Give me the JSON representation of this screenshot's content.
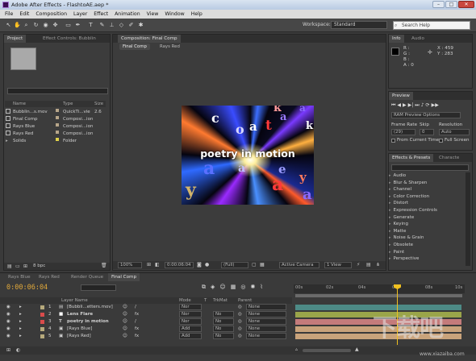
{
  "window": {
    "title": "Adobe After Effects - FlashtoAE.aep *",
    "buttons": [
      "–",
      "□",
      "✕"
    ]
  },
  "menu": [
    "File",
    "Edit",
    "Composition",
    "Layer",
    "Effect",
    "Animation",
    "View",
    "Window",
    "Help"
  ],
  "toolbar": {
    "workspace_label": "Workspace:",
    "workspace_value": "Standard",
    "search_placeholder": "Search Help"
  },
  "project": {
    "tab": "Project",
    "effect_controls_tab": "Effect Controls: Bubblin",
    "columns": [
      "Name",
      "Type",
      "Size"
    ],
    "items": [
      {
        "name": "Bubblin...s.mov",
        "type": "QuickTi...vie",
        "size": "2.6",
        "color": "#b7a68a"
      },
      {
        "name": "Final Comp",
        "type": "Composi...ion",
        "size": "",
        "color": "#b7a68a"
      },
      {
        "name": "Rays Blue",
        "type": "Composi...ion",
        "size": "",
        "color": "#b7a68a"
      },
      {
        "name": "Rays Red",
        "type": "Composi...ion",
        "size": "",
        "color": "#b7a68a"
      },
      {
        "name": "Solids",
        "type": "Folder",
        "size": "",
        "color": "#e0d24a"
      }
    ],
    "bpc": "8 bpc"
  },
  "composition": {
    "panel_tab": "Composition: Final Comp",
    "subtabs": [
      "Final Comp",
      "Rays Red"
    ],
    "viewer_text": "poetry in motion",
    "letters": [
      "c",
      "o",
      "a",
      "k",
      "t",
      "a",
      "a",
      "y",
      "a",
      "a",
      "e",
      "y",
      "a",
      "a",
      "k"
    ],
    "footer": {
      "zoom": "100%",
      "timecode": "0:00:06:04",
      "resolution": "(Full)",
      "camera": "Active Camera",
      "views": "1 View"
    }
  },
  "info": {
    "tab": "Info",
    "audio_tab": "Audio",
    "r": "R :",
    "g": "G :",
    "b": "B :",
    "a": "A : 0",
    "x": "X : 459",
    "y": "Y : 283"
  },
  "preview": {
    "tab": "Preview",
    "ram_options": "RAM Preview Options",
    "frame_rate_label": "Frame Rate",
    "skip_label": "Skip",
    "resolution_label": "Resolution",
    "frame_rate": "(29)",
    "skip": "0",
    "resolution": "Auto",
    "from_current": "From Current Time",
    "full_screen": "Full Screen"
  },
  "effects": {
    "tab": "Effects & Presets",
    "characters_tab": "Characte",
    "search_placeholder": "",
    "items": [
      "Audio",
      "Blur & Sharpen",
      "Channel",
      "Color Correction",
      "Distort",
      "Expression Controls",
      "Generate",
      "Keying",
      "Matte",
      "Noise & Grain",
      "Obsolete",
      "Paint",
      "Perspective"
    ]
  },
  "timeline": {
    "tabs": [
      "Rays Blue",
      "Rays Red",
      "Render Queue",
      "Final Comp"
    ],
    "timecode": "0:00:06:04",
    "header": {
      "layer_name": "Layer Name",
      "mode": "Mode",
      "t": "T",
      "trkmat": "TrkMat",
      "parent": "Parent"
    },
    "ruler": [
      "00s",
      "02s",
      "04s",
      "06s",
      "08s",
      "10s"
    ],
    "playhead_seconds": 6.2,
    "layers": [
      {
        "num": "1",
        "name": "[Bubbli...etters.mov]",
        "mode": "Nor",
        "trkmat": "",
        "parent": "None",
        "color": "#b6a97c",
        "bar": "#4d8a86"
      },
      {
        "num": "2",
        "name": "Lens Flare",
        "mode": "Nor",
        "trkmat": "No",
        "parent": "None",
        "color": "#d94b4b",
        "bar": "#9aa54a"
      },
      {
        "num": "3",
        "name": "poetry in motion",
        "mode": "Nor",
        "trkmat": "No",
        "parent": "None",
        "color": "#d94b4b",
        "bar": "#c47b7b"
      },
      {
        "num": "4",
        "name": "[Rays Blue]",
        "mode": "Add",
        "trkmat": "No",
        "parent": "None",
        "color": "#b6a97c",
        "bar": "#c9a37b"
      },
      {
        "num": "5",
        "name": "[Rays Red]",
        "mode": "Add",
        "trkmat": "No",
        "parent": "None",
        "color": "#b6a97c",
        "bar": "#c9a37b"
      }
    ],
    "toggle_label": "Toggle Switches / Modes"
  },
  "watermark": {
    "text": "下载吧",
    "url": "www.xiazaiba.com"
  }
}
